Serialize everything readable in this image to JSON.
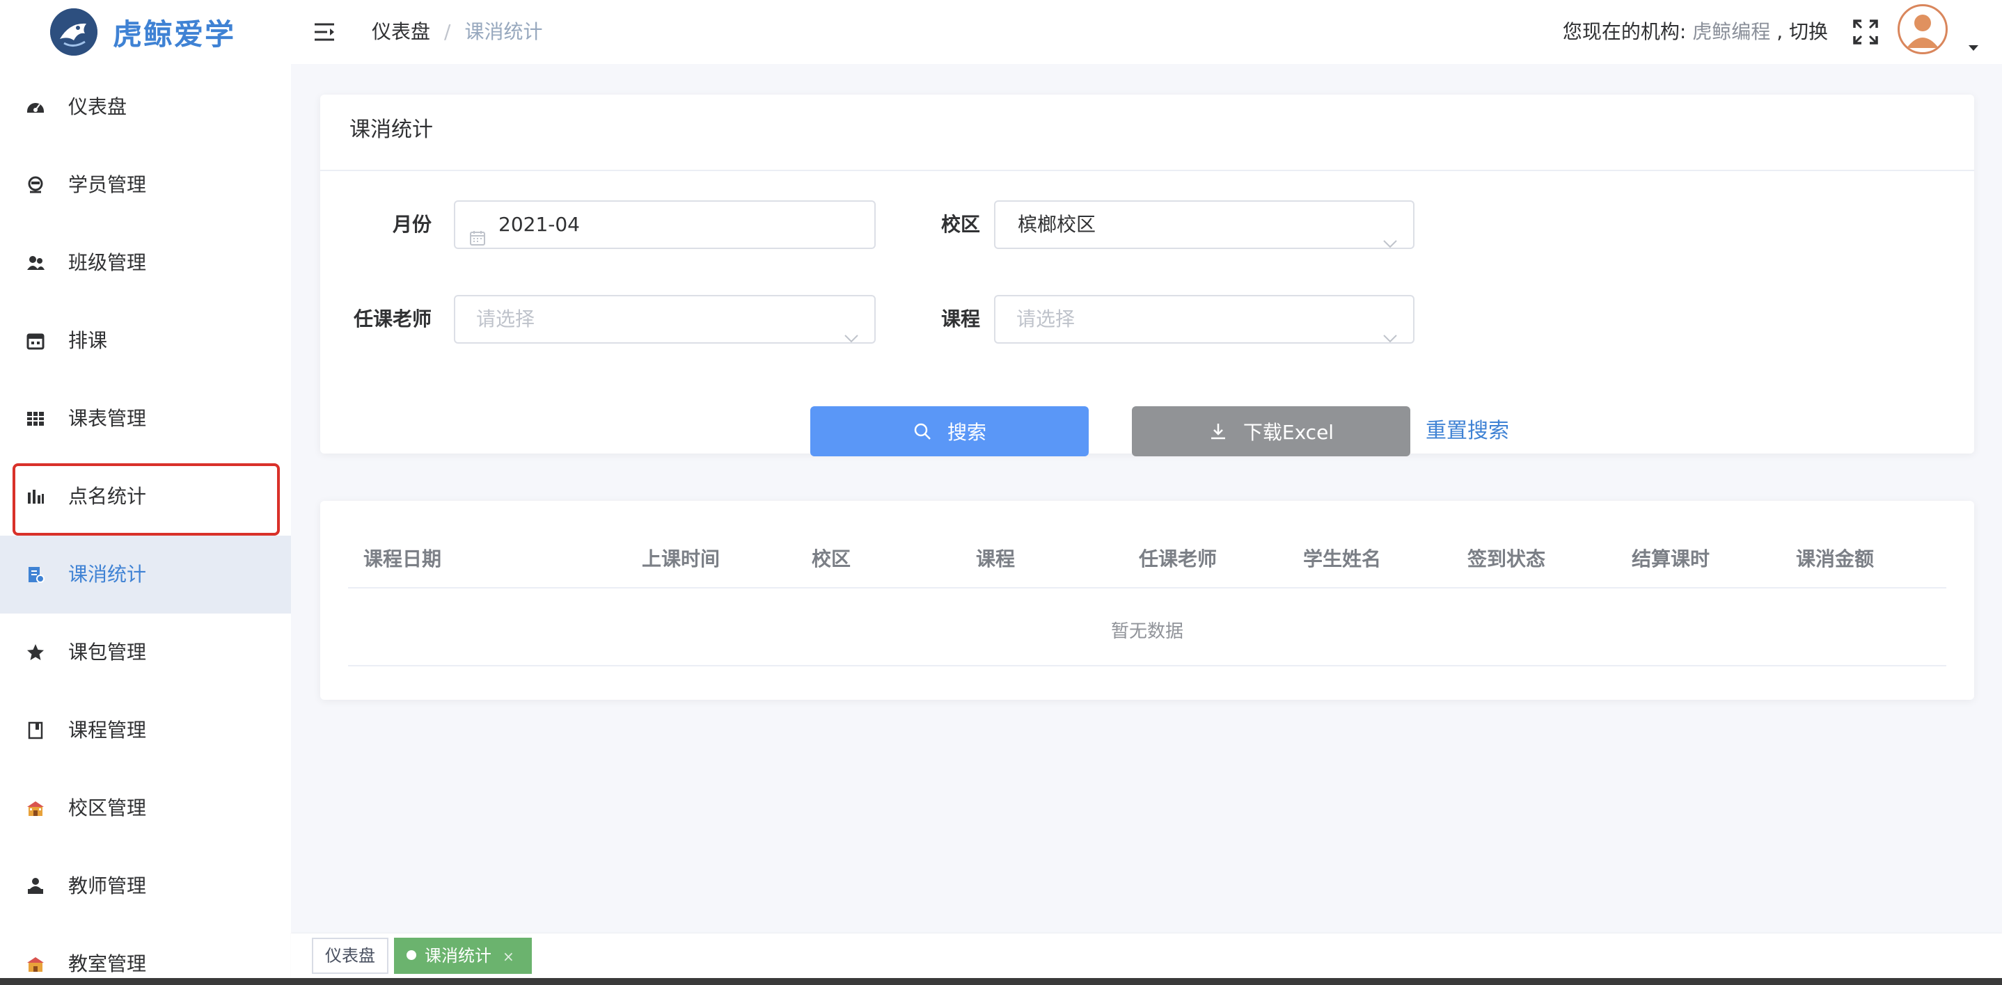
{
  "app": {
    "title": "虎鲸爱学"
  },
  "sidebar": {
    "items": [
      {
        "label": "仪表盘",
        "icon": "dashboard-icon"
      },
      {
        "label": "学员管理",
        "icon": "student-icon"
      },
      {
        "label": "班级管理",
        "icon": "class-icon"
      },
      {
        "label": "排课",
        "icon": "calendar-icon"
      },
      {
        "label": "课表管理",
        "icon": "timetable-icon"
      },
      {
        "label": "点名统计",
        "icon": "bar-chart-icon"
      },
      {
        "label": "课消统计",
        "icon": "consumption-icon"
      },
      {
        "label": "课包管理",
        "icon": "star-icon"
      },
      {
        "label": "课程管理",
        "icon": "book-icon"
      },
      {
        "label": "校区管理",
        "icon": "school-icon"
      },
      {
        "label": "教师管理",
        "icon": "teacher-icon"
      },
      {
        "label": "教室管理",
        "icon": "classroom-icon"
      }
    ],
    "active_index": 6,
    "highlighted_index": 5
  },
  "header": {
    "breadcrumb": {
      "home": "仪表盘",
      "separator": "/",
      "current": "课消统计"
    },
    "org_label": "您现在的机构:",
    "org_name": "虎鲸编程",
    "org_switch": ", 切换"
  },
  "filter": {
    "card_title": "课消统计",
    "month_label": "月份",
    "month_value": "2021-04",
    "campus_label": "校区",
    "campus_value": "槟榔校区",
    "teacher_label": "任课老师",
    "teacher_placeholder": "请选择",
    "course_label": "课程",
    "course_placeholder": "请选择",
    "search_button": "搜索",
    "excel_button": "下载Excel",
    "reset_link": "重置搜索"
  },
  "table": {
    "columns": [
      "课程日期",
      "上课时间",
      "校区",
      "课程",
      "任课老师",
      "学生姓名",
      "签到状态",
      "结算课时",
      "课消金额"
    ],
    "empty_text": "暂无数据"
  },
  "tags": {
    "dashboard": "仪表盘",
    "active": "课消统计",
    "close": "×"
  },
  "colors": {
    "accent": "#3f82d4",
    "search_button": "#5a97f7",
    "excel_button": "#919396",
    "active_tag": "#6bb36e",
    "highlight": "#d9312a"
  }
}
